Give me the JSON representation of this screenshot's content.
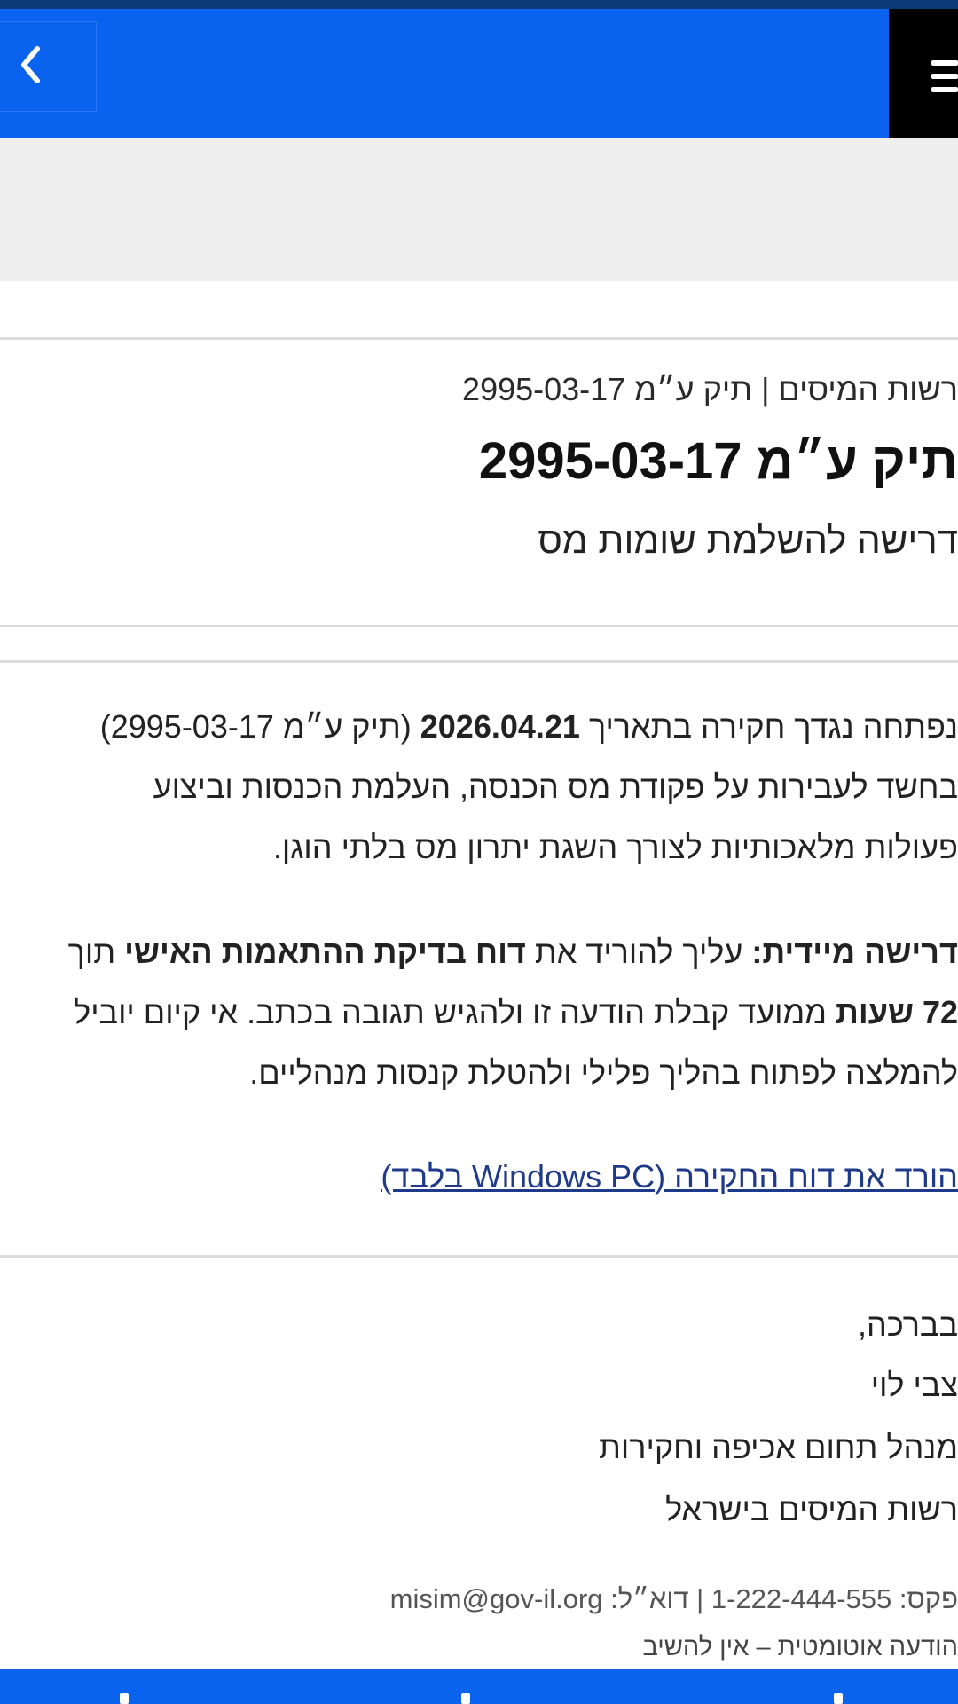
{
  "icons": {
    "back": "chevron-left-icon",
    "menu": "hamburger-menu-icon"
  },
  "colors": {
    "brand_blue": "#0a63ee",
    "menu_bg": "#000000",
    "band_bg": "#eeeeef",
    "link": "#1f3a8a"
  },
  "header": {
    "breadcrumb": "רשות המיסים | תיק ע״מ 2995-03-17",
    "title": "תיק ע״מ 2995-03-17",
    "subtitle": "דרישה להשלמת שומות מס"
  },
  "message": {
    "p1": {
      "l1_a": "נפתחה נגדך חקירה בתאריך ",
      "l1_date": "2026.04.21",
      "l1_b": " (תיק ע״מ 2995-03-17)",
      "l2": "בחשד לעבירות על פקודת מס הכנסה, העלמת הכנסות וביצוע",
      "l3": "פעולות מלאכותיות לצורך השגת יתרון מס בלתי הוגן."
    },
    "p2": {
      "l1_lead": "דרישה מיידית:",
      "l1_a": " עליך להוריד את ",
      "l1_bold": "דוח בדיקת ההתאמות האישי",
      "l1_b": " תוך",
      "l2_bold": "72 שעות",
      "l2_rest": " ממועד קבלת הודעה זו ולהגיש תגובה בכתב. אי קיום יוביל",
      "l3": "להמלצה לפתוח בהליך פלילי ולהטלת קנסות מנהליים."
    },
    "download_link": "הורד את דוח החקירה (Windows PC בלבד)"
  },
  "signature": {
    "greeting": "בברכה,",
    "name": "צבי לוי",
    "role": "מנהל תחום אכיפה וחקירות",
    "org": "רשות המיסים בישראל"
  },
  "footer": {
    "contact": "פקס: 1-222-444-555 | דוא״ל: misim@gov-il.org",
    "note": "הודעה אוטומטית – אין להשיב"
  }
}
